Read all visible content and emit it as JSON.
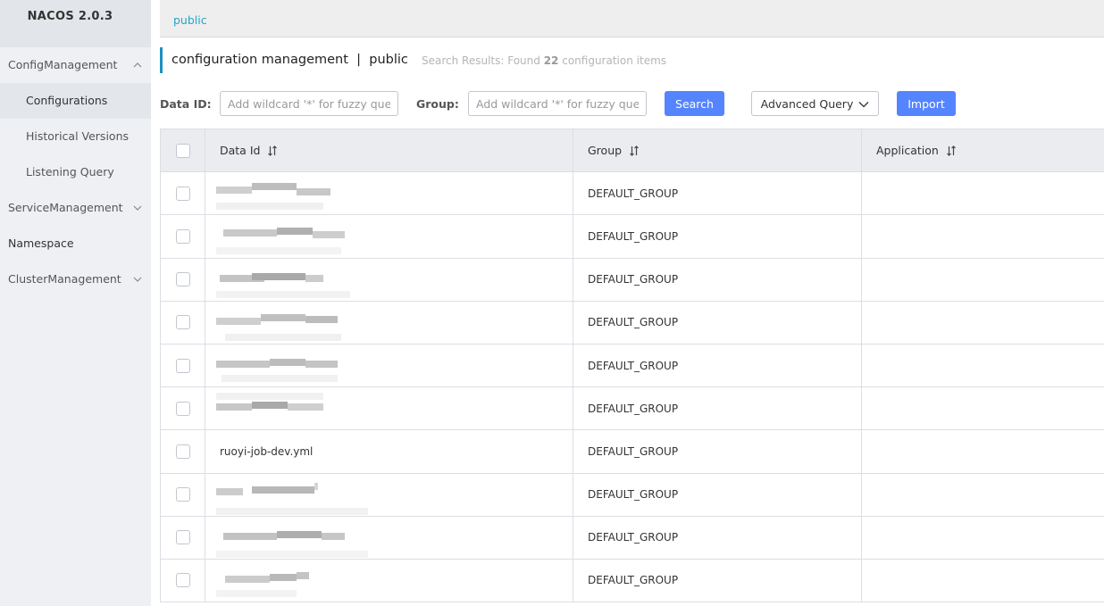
{
  "app": {
    "title": "NACOS 2.0.3"
  },
  "sidebar": {
    "items": [
      {
        "label": "ConfigManagement",
        "type": "group",
        "expanded": true
      },
      {
        "label": "Configurations",
        "type": "sub",
        "active": true
      },
      {
        "label": "Historical Versions",
        "type": "sub"
      },
      {
        "label": "Listening Query",
        "type": "sub"
      },
      {
        "label": "ServiceManagement",
        "type": "group",
        "expanded": false
      },
      {
        "label": "Namespace",
        "type": "plain"
      },
      {
        "label": "ClusterManagement",
        "type": "group",
        "expanded": false
      }
    ]
  },
  "namespace_bar": {
    "current": "public"
  },
  "header": {
    "title": "configuration management  |  public",
    "result_prefix": "Search Results: Found",
    "result_count": "22",
    "result_suffix": "configuration items"
  },
  "filters": {
    "data_id_label": "Data ID:",
    "data_id_placeholder": "Add wildcard '*' for fuzzy query",
    "group_label": "Group:",
    "group_placeholder": "Add wildcard '*' for fuzzy query",
    "search_label": "Search",
    "advanced_label": "Advanced Query",
    "import_label": "Import"
  },
  "table": {
    "columns": [
      "Data Id",
      "Group",
      "Application"
    ],
    "rows": [
      {
        "data_id": "",
        "redacted": true,
        "group": "DEFAULT_GROUP",
        "application": ""
      },
      {
        "data_id": "",
        "redacted": true,
        "group": "DEFAULT_GROUP",
        "application": ""
      },
      {
        "data_id": "",
        "redacted": true,
        "group": "DEFAULT_GROUP",
        "application": ""
      },
      {
        "data_id": "",
        "redacted": true,
        "group": "DEFAULT_GROUP",
        "application": ""
      },
      {
        "data_id": "",
        "redacted": true,
        "group": "DEFAULT_GROUP",
        "application": ""
      },
      {
        "data_id": "",
        "redacted": true,
        "group": "DEFAULT_GROUP",
        "application": ""
      },
      {
        "data_id": "ruoyi-job-dev.yml",
        "redacted": false,
        "group": "DEFAULT_GROUP",
        "application": ""
      },
      {
        "data_id": "",
        "redacted": true,
        "group": "DEFAULT_GROUP",
        "application": ""
      },
      {
        "data_id": "",
        "redacted": true,
        "group": "DEFAULT_GROUP",
        "application": ""
      },
      {
        "data_id": "",
        "redacted": true,
        "group": "DEFAULT_GROUP",
        "application": ""
      }
    ]
  },
  "colors": {
    "accent": "#5584ff",
    "link": "#26a4c7",
    "header_bar": "#1d8fc2"
  }
}
